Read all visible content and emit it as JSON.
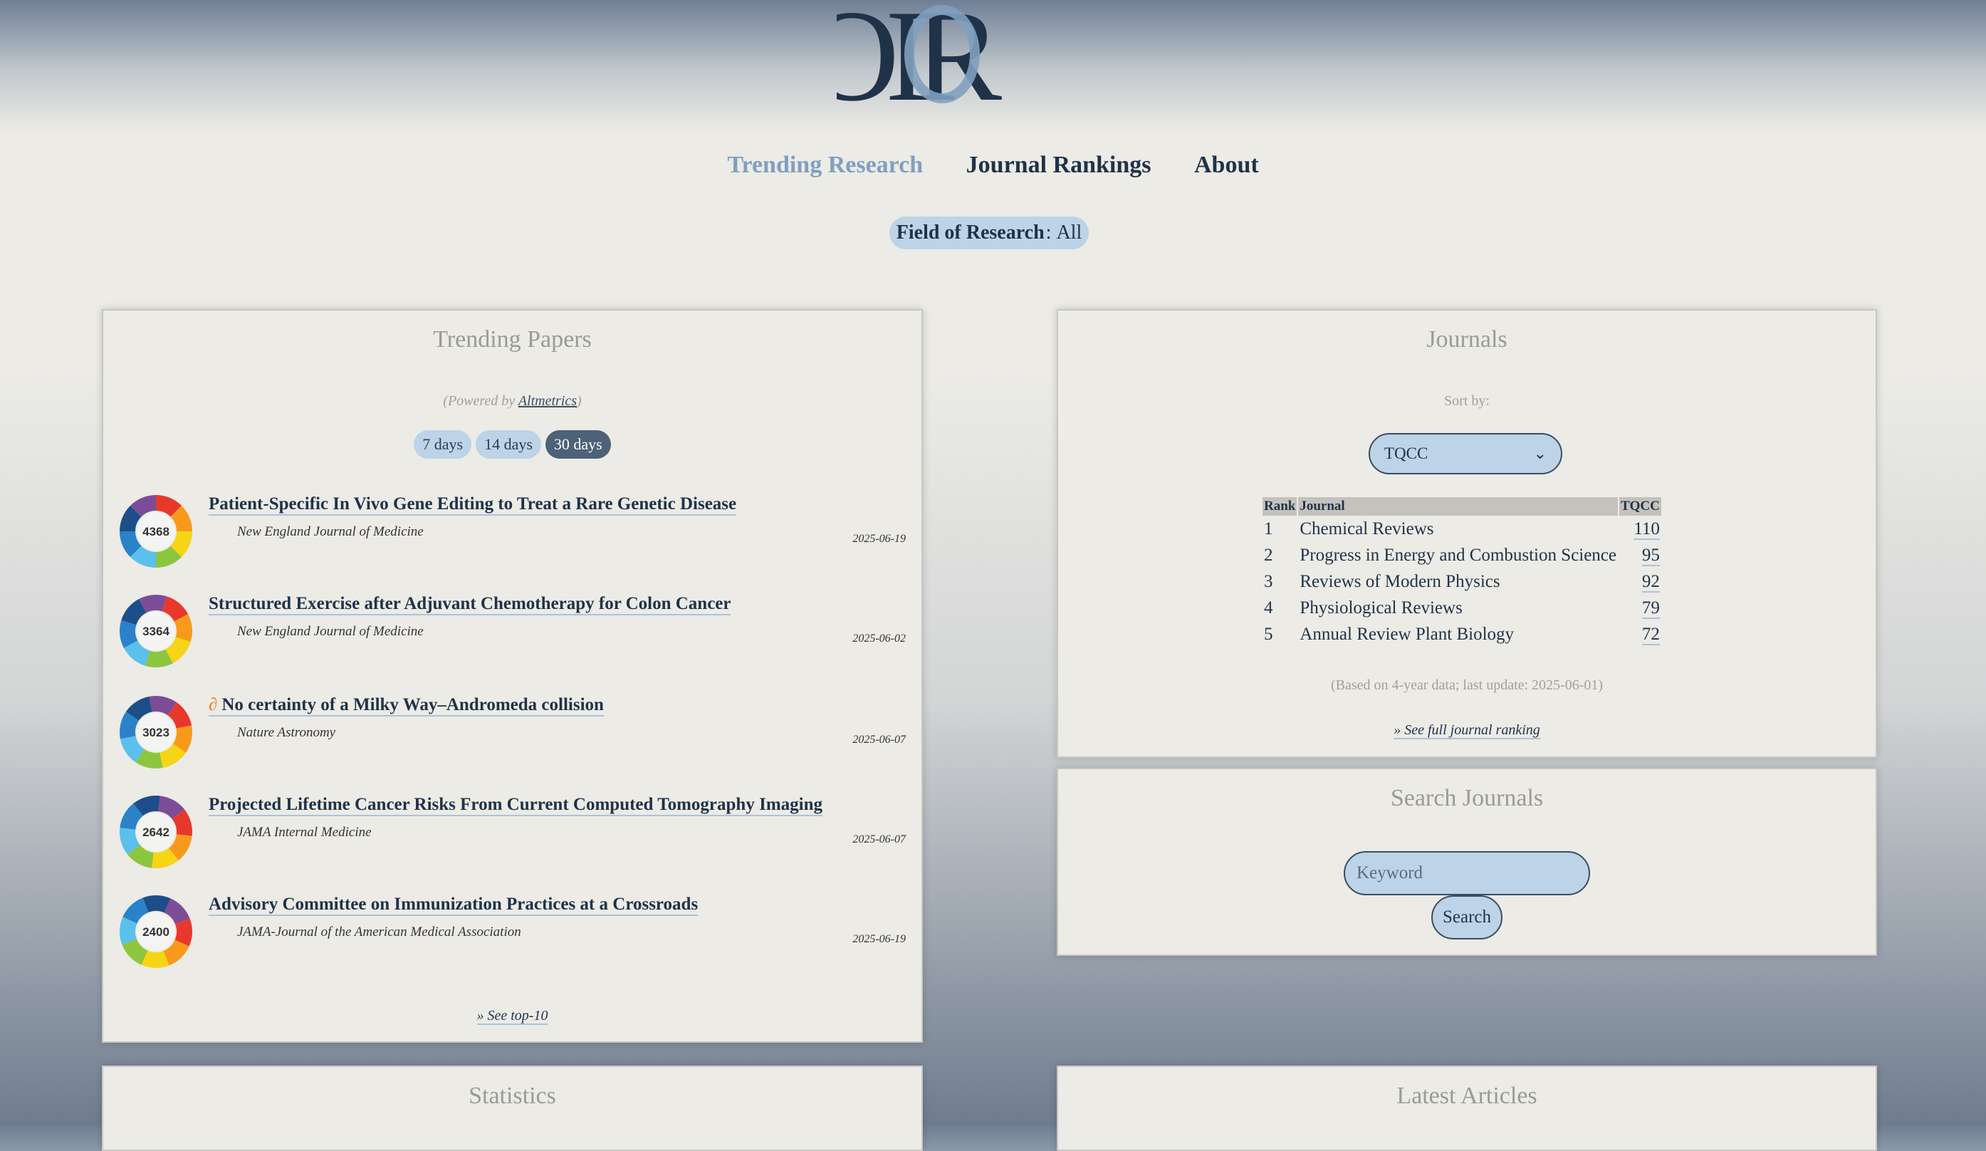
{
  "brand": {
    "logo_text": "OOIR"
  },
  "nav": {
    "items": [
      {
        "label": "Trending Research",
        "active": true
      },
      {
        "label": "Journal Rankings",
        "active": false
      },
      {
        "label": "About",
        "active": false
      }
    ]
  },
  "field": {
    "label": "Field of Research",
    "separator": ":",
    "value": "All"
  },
  "trending": {
    "title": "Trending Papers",
    "powered_prefix": "(Powered by",
    "powered_link": "Altmetrics",
    "powered_suffix": ")",
    "ranges": [
      {
        "label": "7 days",
        "active": false
      },
      {
        "label": "14 days",
        "active": false
      },
      {
        "label": "30 days",
        "active": true
      }
    ],
    "papers": [
      {
        "score": "4368",
        "title": "Patient-Specific In Vivo Gene Editing to Treat a Rare Genetic Disease",
        "journal": "New England Journal of Medicine",
        "date": "2025-06-19",
        "open_access": false
      },
      {
        "score": "3364",
        "title": "Structured Exercise after Adjuvant Chemotherapy for Colon Cancer",
        "journal": "New England Journal of Medicine",
        "date": "2025-06-02",
        "open_access": false
      },
      {
        "score": "3023",
        "title": "No certainty of a Milky Way–Andromeda collision",
        "journal": "Nature Astronomy",
        "date": "2025-06-07",
        "open_access": true
      },
      {
        "score": "2642",
        "title": "Projected Lifetime Cancer Risks From Current Computed Tomography Imaging",
        "journal": "JAMA Internal Medicine",
        "date": "2025-06-07",
        "open_access": false
      },
      {
        "score": "2400",
        "title": "Advisory Committee on Immunization Practices at a Crossroads",
        "journal": "JAMA-Journal of the American Medical Association",
        "date": "2025-06-19",
        "open_access": false
      }
    ],
    "see_more": "» See top-10"
  },
  "journals": {
    "title": "Journals",
    "sort_label": "Sort by:",
    "sort_value": "TQCC",
    "columns": [
      "Rank",
      "Journal",
      "TQCC"
    ],
    "rows": [
      {
        "rank": "1",
        "journal": "Chemical Reviews",
        "score": "110"
      },
      {
        "rank": "2",
        "journal": "Progress in Energy and Combustion Science",
        "score": "95"
      },
      {
        "rank": "3",
        "journal": "Reviews of Modern Physics",
        "score": "92"
      },
      {
        "rank": "4",
        "journal": "Physiological Reviews",
        "score": "79"
      },
      {
        "rank": "5",
        "journal": "Annual Review Plant Biology",
        "score": "72"
      }
    ],
    "footnote": "(Based on 4-year data; last update: 2025-06-01)",
    "see_full": "» See full journal ranking"
  },
  "search": {
    "title": "Search Journals",
    "placeholder": "Keyword",
    "button": "Search"
  },
  "statistics": {
    "title": "Statistics"
  },
  "latest": {
    "title": "Latest Articles"
  },
  "colors": {
    "accent": "#7fa0bf",
    "navy": "#1f3248",
    "pill": "#bcd3e8",
    "pill_active": "#4d6178",
    "oa_orange": "#e9801a"
  }
}
